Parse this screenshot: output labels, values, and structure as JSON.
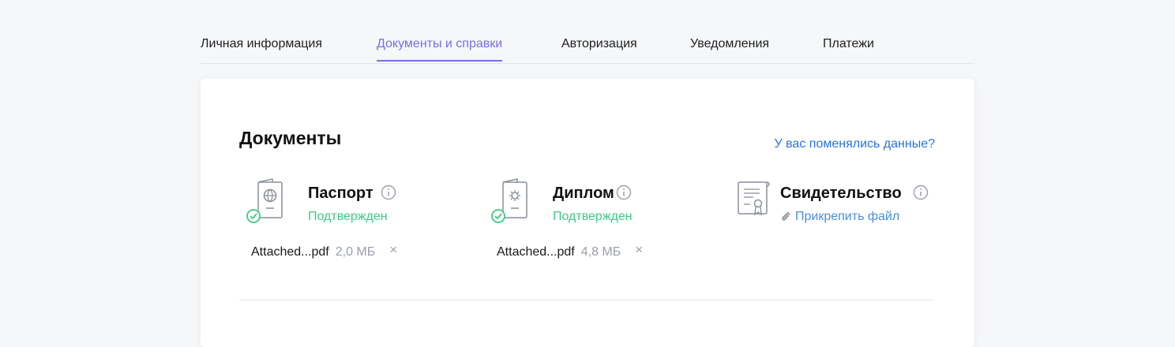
{
  "tabs": [
    {
      "label": "Личная информация",
      "active": false
    },
    {
      "label": "Документы и справки",
      "active": true
    },
    {
      "label": "Авторизация",
      "active": false
    },
    {
      "label": "Уведомления",
      "active": false
    },
    {
      "label": "Платежи",
      "active": false
    }
  ],
  "section": {
    "title": "Документы",
    "change_link": "У вас поменялись данные?"
  },
  "documents": [
    {
      "name": "Паспорт",
      "icon": "passport-icon",
      "status": "Подтвержден",
      "file_name": "Attached...pdf",
      "file_size": "2,0 МБ",
      "remove": "×"
    },
    {
      "name": "Диплом",
      "icon": "diploma-icon",
      "status": "Подтвержден",
      "file_name": "Attached...pdf",
      "file_size": "4,8 МБ",
      "remove": "×"
    },
    {
      "name": "Свидетельство",
      "icon": "certificate-icon",
      "attach_label": "Прикрепить файл"
    }
  ],
  "colors": {
    "accent": "#7b6ee0",
    "link": "#2a73d6",
    "success": "#3fca86",
    "muted": "#9a9fa8"
  }
}
